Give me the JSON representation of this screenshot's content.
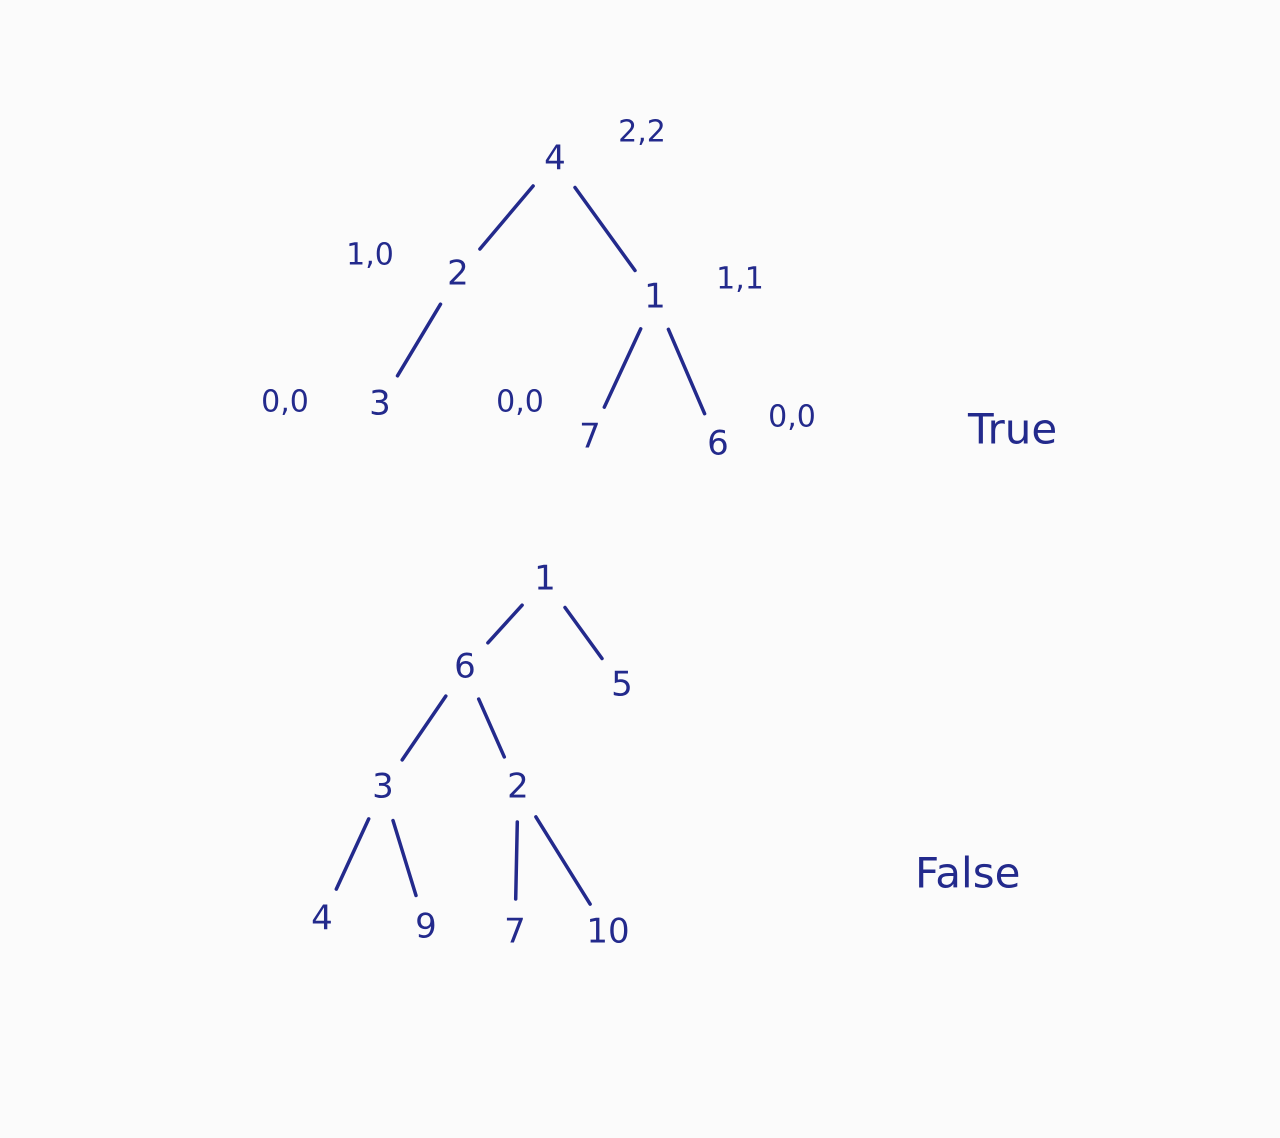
{
  "trees": [
    {
      "verdict": "True",
      "nodes": [
        {
          "id": "a1",
          "label": "4",
          "annotation": "2,2"
        },
        {
          "id": "a2",
          "label": "2",
          "annotation": "1,0"
        },
        {
          "id": "a3",
          "label": "1",
          "annotation": "1,1"
        },
        {
          "id": "a4",
          "label": "3",
          "annotation": "0,0"
        },
        {
          "id": "a5",
          "label": "7",
          "annotation": "0,0"
        },
        {
          "id": "a6",
          "label": "6",
          "annotation": "0,0"
        }
      ],
      "edges": [
        [
          "a1",
          "a2"
        ],
        [
          "a1",
          "a3"
        ],
        [
          "a2",
          "a4"
        ],
        [
          "a3",
          "a5"
        ],
        [
          "a3",
          "a6"
        ]
      ]
    },
    {
      "verdict": "False",
      "nodes": [
        {
          "id": "b1",
          "label": "1"
        },
        {
          "id": "b2",
          "label": "6"
        },
        {
          "id": "b3",
          "label": "5"
        },
        {
          "id": "b4",
          "label": "3"
        },
        {
          "id": "b5",
          "label": "2"
        },
        {
          "id": "b6",
          "label": "4"
        },
        {
          "id": "b7",
          "label": "9"
        },
        {
          "id": "b8",
          "label": "7"
        },
        {
          "id": "b9",
          "label": "10"
        }
      ],
      "edges": [
        [
          "b1",
          "b2"
        ],
        [
          "b1",
          "b3"
        ],
        [
          "b2",
          "b4"
        ],
        [
          "b2",
          "b5"
        ],
        [
          "b4",
          "b6"
        ],
        [
          "b4",
          "b7"
        ],
        [
          "b5",
          "b8"
        ],
        [
          "b5",
          "b9"
        ]
      ]
    }
  ]
}
